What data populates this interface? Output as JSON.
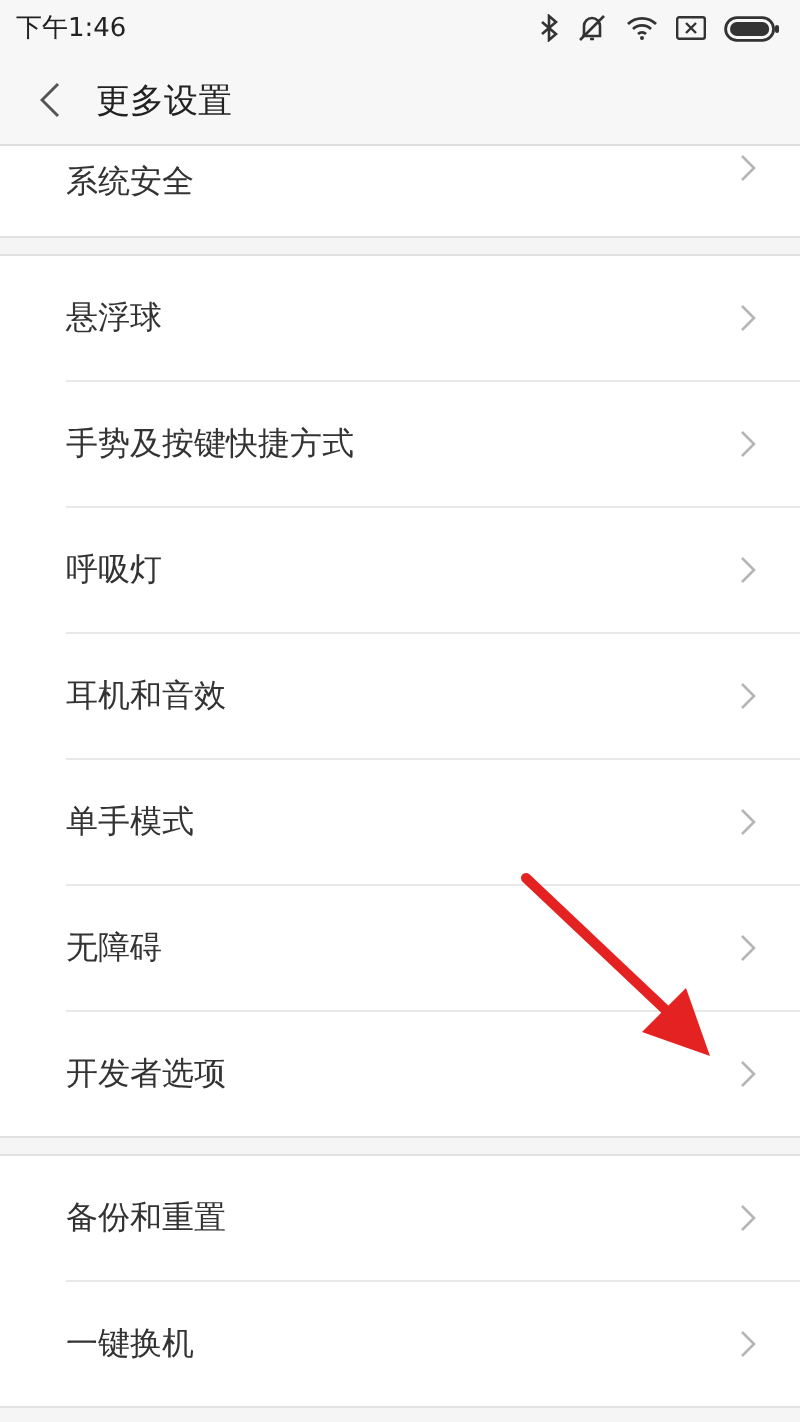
{
  "status_bar": {
    "time": "下午1:46"
  },
  "header": {
    "title": "更多设置"
  },
  "groups": [
    {
      "cut": true,
      "items": [
        {
          "label": "系统安全"
        }
      ]
    },
    {
      "cut": false,
      "items": [
        {
          "label": "悬浮球"
        },
        {
          "label": "手势及按键快捷方式"
        },
        {
          "label": "呼吸灯"
        },
        {
          "label": "耳机和音效"
        },
        {
          "label": "单手模式"
        },
        {
          "label": "无障碍"
        },
        {
          "label": "开发者选项"
        }
      ]
    },
    {
      "cut": false,
      "items": [
        {
          "label": "备份和重置"
        },
        {
          "label": "一键换机"
        }
      ]
    }
  ]
}
